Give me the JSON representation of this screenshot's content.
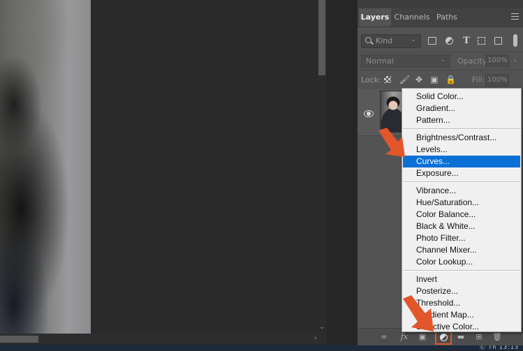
{
  "panel": {
    "tabs": [
      {
        "label": "Layers",
        "active": true
      },
      {
        "label": "Channels",
        "active": false
      },
      {
        "label": "Paths",
        "active": false
      }
    ],
    "filter": {
      "kind_label": "Kind",
      "icons": [
        "image-filter-icon",
        "adjustment-filter-icon",
        "type-filter-icon",
        "shape-filter-icon",
        "smart-object-filter-icon",
        "filter-toggle-icon"
      ]
    },
    "blend": {
      "mode": "Normal",
      "opacity_label": "Opacity:",
      "opacity_value": "100%"
    },
    "lock": {
      "label": "Lock:",
      "fill_label": "Fill:",
      "fill_value": "100%"
    },
    "layer": {
      "visible": true
    },
    "footer_icons": [
      "link-icon",
      "fx-icon",
      "mask-icon",
      "adjustment-layer-icon",
      "group-icon",
      "new-layer-icon",
      "trash-icon"
    ]
  },
  "menu": {
    "groups": [
      [
        "Solid Color...",
        "Gradient...",
        "Pattern..."
      ],
      [
        "Brightness/Contrast...",
        "Levels...",
        "Curves...",
        "Exposure..."
      ],
      [
        "Vibrance...",
        "Hue/Saturation...",
        "Color Balance...",
        "Black & White...",
        "Photo Filter...",
        "Channel Mixer...",
        "Color Lookup..."
      ],
      [
        "Invert",
        "Posterize...",
        "Threshold...",
        "Gradient Map...",
        "Selective Color..."
      ]
    ],
    "highlighted": "Curves..."
  },
  "clock": "Ⓒ Th 13:13",
  "colors": {
    "accent_arrow": "#e3562b",
    "highlight": "#0a70d6",
    "panel_bg": "#535353"
  }
}
